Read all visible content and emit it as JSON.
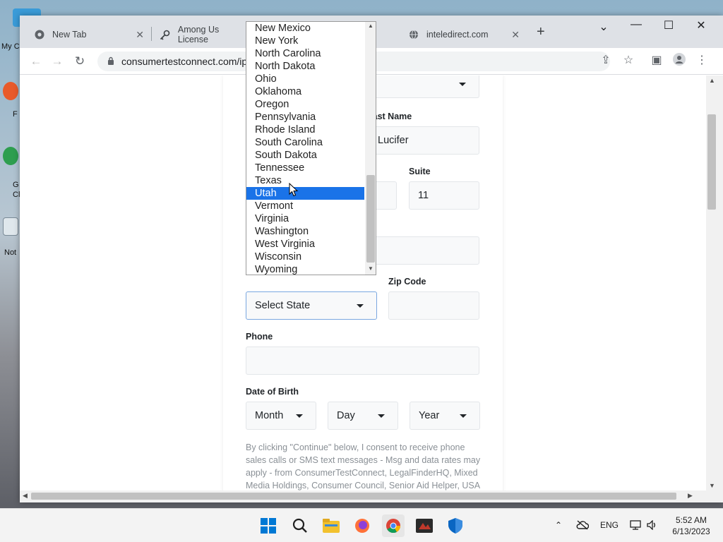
{
  "desktop": {
    "labels": [
      "My C",
      "F",
      "G",
      "Cl",
      "Not"
    ]
  },
  "browser": {
    "tabs": [
      {
        "label": "New Tab",
        "icon": "chrome-icon"
      },
      {
        "label": "Among Us License",
        "icon": "key-icon"
      },
      {
        "label": "inteledirect.com",
        "icon": "globe-icon"
      }
    ],
    "url": "consumertestconnect.com/ip"
  },
  "form": {
    "last_name_label": "Last Name",
    "last_name_value": "Lucifer",
    "suite_label": "Suite",
    "suite_value": "11",
    "zip_label": "Zip Code",
    "state_select_value": "Select State",
    "phone_label": "Phone",
    "dob_label": "Date of Birth",
    "dob_month": "Month",
    "dob_day": "Day",
    "dob_year": "Year",
    "consent_text": "By clicking \"Continue\" below, I consent to receive phone sales calls or SMS text messages - Msg and data rates may apply - from ConsumerTestConnect, LegalFinderHQ, Mixed Media Holdings, Consumer Council, Senior Aid Helper, USA Rate Center, Med Advantage Advisors ,"
  },
  "dropdown": {
    "options": [
      "New Mexico",
      "New York",
      "North Carolina",
      "North Dakota",
      "Ohio",
      "Oklahoma",
      "Oregon",
      "Pennsylvania",
      "Rhode Island",
      "South Carolina",
      "South Dakota",
      "Tennessee",
      "Texas",
      "Utah",
      "Vermont",
      "Virginia",
      "Washington",
      "West Virginia",
      "Wisconsin",
      "Wyoming"
    ],
    "highlighted": "Utah"
  },
  "taskbar": {
    "language": "ENG",
    "time": "5:52 AM",
    "date": "6/13/2023"
  },
  "colors": {
    "highlight": "#1a73e8",
    "tabstrip": "#dee1e6",
    "taskbar": "#f3f3f3"
  }
}
